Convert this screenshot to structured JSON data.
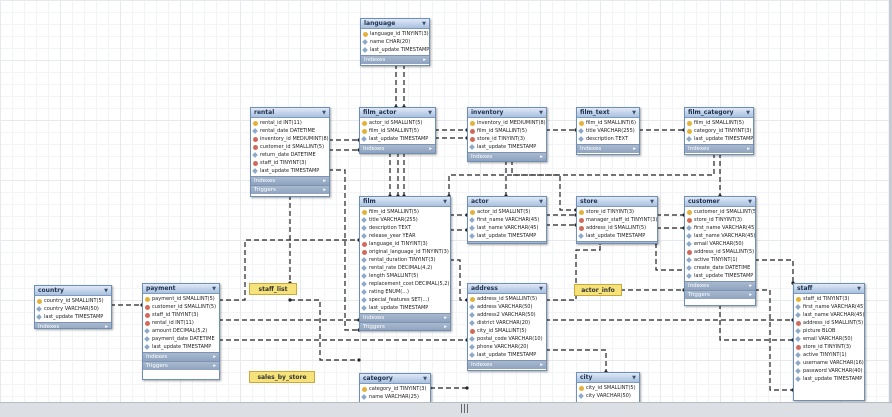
{
  "tables": {
    "language": {
      "name": "language",
      "fields": [
        {
          "t": "pk",
          "text": "language_id TINYINT(3)"
        },
        {
          "t": "col",
          "text": "name CHAR(20)"
        },
        {
          "t": "col",
          "text": "last_update TIMESTAMP"
        }
      ],
      "sections": [
        "Indexes"
      ]
    },
    "rental": {
      "name": "rental",
      "fields": [
        {
          "t": "pk",
          "text": "rental_id INT(11)"
        },
        {
          "t": "col",
          "text": "rental_date DATETIME"
        },
        {
          "t": "fk",
          "text": "inventory_id MEDIUMINT(8)"
        },
        {
          "t": "fk",
          "text": "customer_id SMALLINT(5)"
        },
        {
          "t": "col",
          "text": "return_date DATETIME"
        },
        {
          "t": "fk",
          "text": "staff_id TINYINT(3)"
        },
        {
          "t": "col",
          "text": "last_update TIMESTAMP"
        }
      ],
      "sections": [
        "Indexes",
        "Triggers"
      ]
    },
    "film_actor": {
      "name": "film_actor",
      "fields": [
        {
          "t": "pk",
          "text": "actor_id SMALLINT(5)"
        },
        {
          "t": "pk",
          "text": "film_id SMALLINT(5)"
        },
        {
          "t": "col",
          "text": "last_update TIMESTAMP"
        }
      ],
      "sections": [
        "Indexes"
      ]
    },
    "inventory": {
      "name": "inventory",
      "fields": [
        {
          "t": "pk",
          "text": "inventory_id MEDIUMINT(8)"
        },
        {
          "t": "fk",
          "text": "film_id SMALLINT(5)"
        },
        {
          "t": "fk",
          "text": "store_id TINYINT(3)"
        },
        {
          "t": "col",
          "text": "last_update TIMESTAMP"
        }
      ],
      "sections": [
        "Indexes"
      ]
    },
    "film_text": {
      "name": "film_text",
      "fields": [
        {
          "t": "pk",
          "text": "film_id SMALLINT(6)"
        },
        {
          "t": "col",
          "text": "title VARCHAR(255)"
        },
        {
          "t": "col",
          "text": "description TEXT"
        }
      ],
      "sections": [
        "Indexes"
      ]
    },
    "film_category": {
      "name": "film_category",
      "fields": [
        {
          "t": "pk",
          "text": "film_id SMALLINT(5)"
        },
        {
          "t": "pk",
          "text": "category_id TINYINT(3)"
        },
        {
          "t": "col",
          "text": "last_update TIMESTAMP"
        }
      ],
      "sections": [
        "Indexes"
      ]
    },
    "film": {
      "name": "film",
      "fields": [
        {
          "t": "pk",
          "text": "film_id SMALLINT(5)"
        },
        {
          "t": "col",
          "text": "title VARCHAR(255)"
        },
        {
          "t": "col",
          "text": "description TEXT"
        },
        {
          "t": "col",
          "text": "release_year YEAR"
        },
        {
          "t": "fk",
          "text": "language_id TINYINT(3)"
        },
        {
          "t": "fk",
          "text": "original_language_id TINYINT(3)"
        },
        {
          "t": "col",
          "text": "rental_duration TINYINT(3)"
        },
        {
          "t": "col",
          "text": "rental_rate DECIMAL(4,2)"
        },
        {
          "t": "col",
          "text": "length SMALLINT(5)"
        },
        {
          "t": "col",
          "text": "replacement_cost DECIMAL(5,2)"
        },
        {
          "t": "col",
          "text": "rating ENUM(...)"
        },
        {
          "t": "col",
          "text": "special_features SET(...)"
        },
        {
          "t": "col",
          "text": "last_update TIMESTAMP"
        }
      ],
      "sections": [
        "Indexes",
        "Triggers"
      ]
    },
    "actor": {
      "name": "actor",
      "fields": [
        {
          "t": "pk",
          "text": "actor_id SMALLINT(5)"
        },
        {
          "t": "col",
          "text": "first_name VARCHAR(45)"
        },
        {
          "t": "col",
          "text": "last_name VARCHAR(45)"
        },
        {
          "t": "col",
          "text": "last_update TIMESTAMP"
        }
      ],
      "sections": [
        "Indexes"
      ]
    },
    "store": {
      "name": "store",
      "fields": [
        {
          "t": "pk",
          "text": "store_id TINYINT(3)"
        },
        {
          "t": "fk",
          "text": "manager_staff_id TINYINT(3)"
        },
        {
          "t": "fk",
          "text": "address_id SMALLINT(5)"
        },
        {
          "t": "col",
          "text": "last_update TIMESTAMP"
        }
      ],
      "sections": [
        "Indexes"
      ]
    },
    "customer": {
      "name": "customer",
      "fields": [
        {
          "t": "pk",
          "text": "customer_id SMALLINT(5)"
        },
        {
          "t": "fk",
          "text": "store_id TINYINT(3)"
        },
        {
          "t": "col",
          "text": "first_name VARCHAR(45)"
        },
        {
          "t": "col",
          "text": "last_name VARCHAR(45)"
        },
        {
          "t": "col",
          "text": "email VARCHAR(50)"
        },
        {
          "t": "fk",
          "text": "address_id SMALLINT(5)"
        },
        {
          "t": "col",
          "text": "active TINYINT(1)"
        },
        {
          "t": "col",
          "text": "create_date DATETIME"
        },
        {
          "t": "col",
          "text": "last_update TIMESTAMP"
        }
      ],
      "sections": [
        "Indexes",
        "Triggers"
      ]
    },
    "country": {
      "name": "country",
      "fields": [
        {
          "t": "pk",
          "text": "country_id SMALLINT(5)"
        },
        {
          "t": "col",
          "text": "country VARCHAR(50)"
        },
        {
          "t": "col",
          "text": "last_update TIMESTAMP"
        }
      ],
      "sections": [
        "Indexes"
      ]
    },
    "payment": {
      "name": "payment",
      "fields": [
        {
          "t": "pk",
          "text": "payment_id SMALLINT(5)"
        },
        {
          "t": "fk",
          "text": "customer_id SMALLINT(5)"
        },
        {
          "t": "fk",
          "text": "staff_id TINYINT(3)"
        },
        {
          "t": "fk",
          "text": "rental_id INT(11)"
        },
        {
          "t": "col",
          "text": "amount DECIMAL(5,2)"
        },
        {
          "t": "col",
          "text": "payment_date DATETIME"
        },
        {
          "t": "col",
          "text": "last_update TIMESTAMP"
        }
      ],
      "sections": [
        "Indexes",
        "Triggers"
      ]
    },
    "address": {
      "name": "address",
      "fields": [
        {
          "t": "pk",
          "text": "address_id SMALLINT(5)"
        },
        {
          "t": "col",
          "text": "address VARCHAR(50)"
        },
        {
          "t": "col",
          "text": "address2 VARCHAR(50)"
        },
        {
          "t": "col",
          "text": "district VARCHAR(20)"
        },
        {
          "t": "fk",
          "text": "city_id SMALLINT(5)"
        },
        {
          "t": "col",
          "text": "postal_code VARCHAR(10)"
        },
        {
          "t": "col",
          "text": "phone VARCHAR(20)"
        },
        {
          "t": "col",
          "text": "last_update TIMESTAMP"
        }
      ],
      "sections": [
        "Indexes"
      ]
    },
    "staff": {
      "name": "staff",
      "fields": [
        {
          "t": "pk",
          "text": "staff_id TINYINT(3)"
        },
        {
          "t": "col",
          "text": "first_name VARCHAR(45)"
        },
        {
          "t": "col",
          "text": "last_name VARCHAR(45)"
        },
        {
          "t": "fk",
          "text": "address_id SMALLINT(5)"
        },
        {
          "t": "col",
          "text": "picture BLOB"
        },
        {
          "t": "col",
          "text": "email VARCHAR(50)"
        },
        {
          "t": "fk",
          "text": "store_id TINYINT(3)"
        },
        {
          "t": "col",
          "text": "active TINYINT(1)"
        },
        {
          "t": "col",
          "text": "username VARCHAR(16)"
        },
        {
          "t": "col",
          "text": "password VARCHAR(40)"
        },
        {
          "t": "col",
          "text": "last_update TIMESTAMP"
        }
      ],
      "sections": []
    },
    "category": {
      "name": "category",
      "fields": [
        {
          "t": "pk",
          "text": "category_id TINYINT(3)"
        },
        {
          "t": "col",
          "text": "name VARCHAR(25)"
        }
      ],
      "sections": []
    },
    "city": {
      "name": "city",
      "fields": [
        {
          "t": "pk",
          "text": "city_id SMALLINT(5)"
        },
        {
          "t": "col",
          "text": "city VARCHAR(50)"
        }
      ],
      "sections": []
    }
  },
  "notes": {
    "staff_list": "staff_list",
    "actor_info": "actor_info",
    "sales_by_store": "sales_by_store"
  },
  "icons": {
    "dropdown": "dropdown-arrow-icon",
    "grip": "resize-grip-icon"
  },
  "grip_glyph": "|||",
  "colors": {
    "header_top": "#dfe9f6",
    "header_bottom": "#a9c1df",
    "section": "#9db0c9",
    "note": "#f5e27a",
    "line": "#222222"
  }
}
